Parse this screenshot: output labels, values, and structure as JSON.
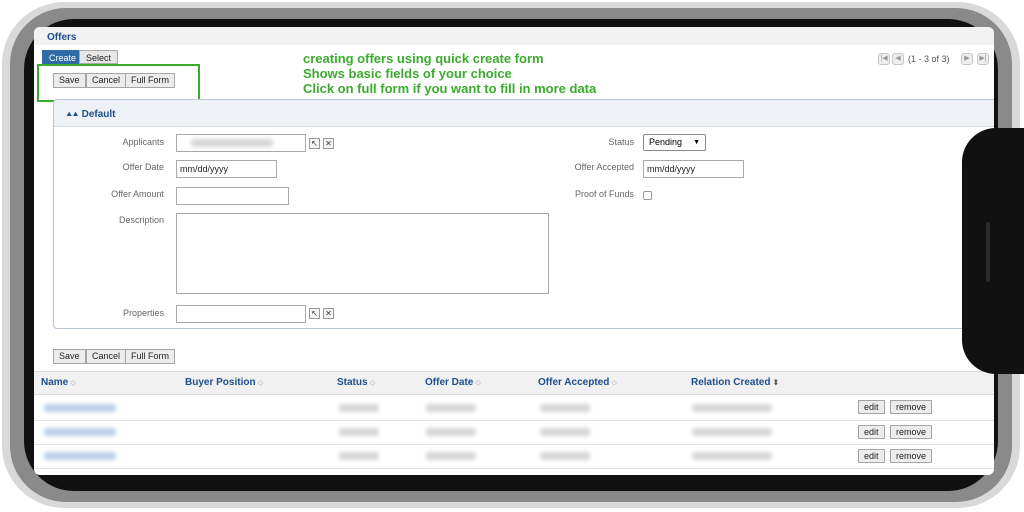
{
  "header": {
    "title": "Offers"
  },
  "tabs": [
    {
      "label": "Create"
    },
    {
      "label": "Select"
    }
  ],
  "toolbar": {
    "save": "Save",
    "cancel": "Cancel",
    "full_form": "Full Form"
  },
  "annotation": [
    "creating offers using quick create form",
    "Shows basic fields of your choice",
    "Click on full form if you want to fill in more data"
  ],
  "pager": {
    "text": "(1 - 3 of 3)"
  },
  "panel": {
    "title": "Default",
    "collapse_icon": "double-chevron-up-icon"
  },
  "form": {
    "applicants_label": "Applicants",
    "offer_date_label": "Offer Date",
    "offer_date_value": "mm/dd/yyyy",
    "offer_amount_label": "Offer Amount",
    "description_label": "Description",
    "properties_label": "Properties",
    "status_label": "Status",
    "status_value": "Pending",
    "offer_accepted_label": "Offer Accepted",
    "offer_accepted_value": "mm/dd/yyyy",
    "proof_of_funds_label": "Proof of Funds"
  },
  "table": {
    "columns": [
      "Name",
      "Buyer Position",
      "Status",
      "Offer Date",
      "Offer Accepted",
      "Relation Created"
    ],
    "sort_icon": "sort-icon",
    "row_actions": {
      "edit": "edit",
      "remove": "remove"
    },
    "row_count": 3
  },
  "colors": {
    "accent": "#1d4f8c",
    "annotation": "#3bab2d",
    "active_tab": "#2f6ca6"
  }
}
